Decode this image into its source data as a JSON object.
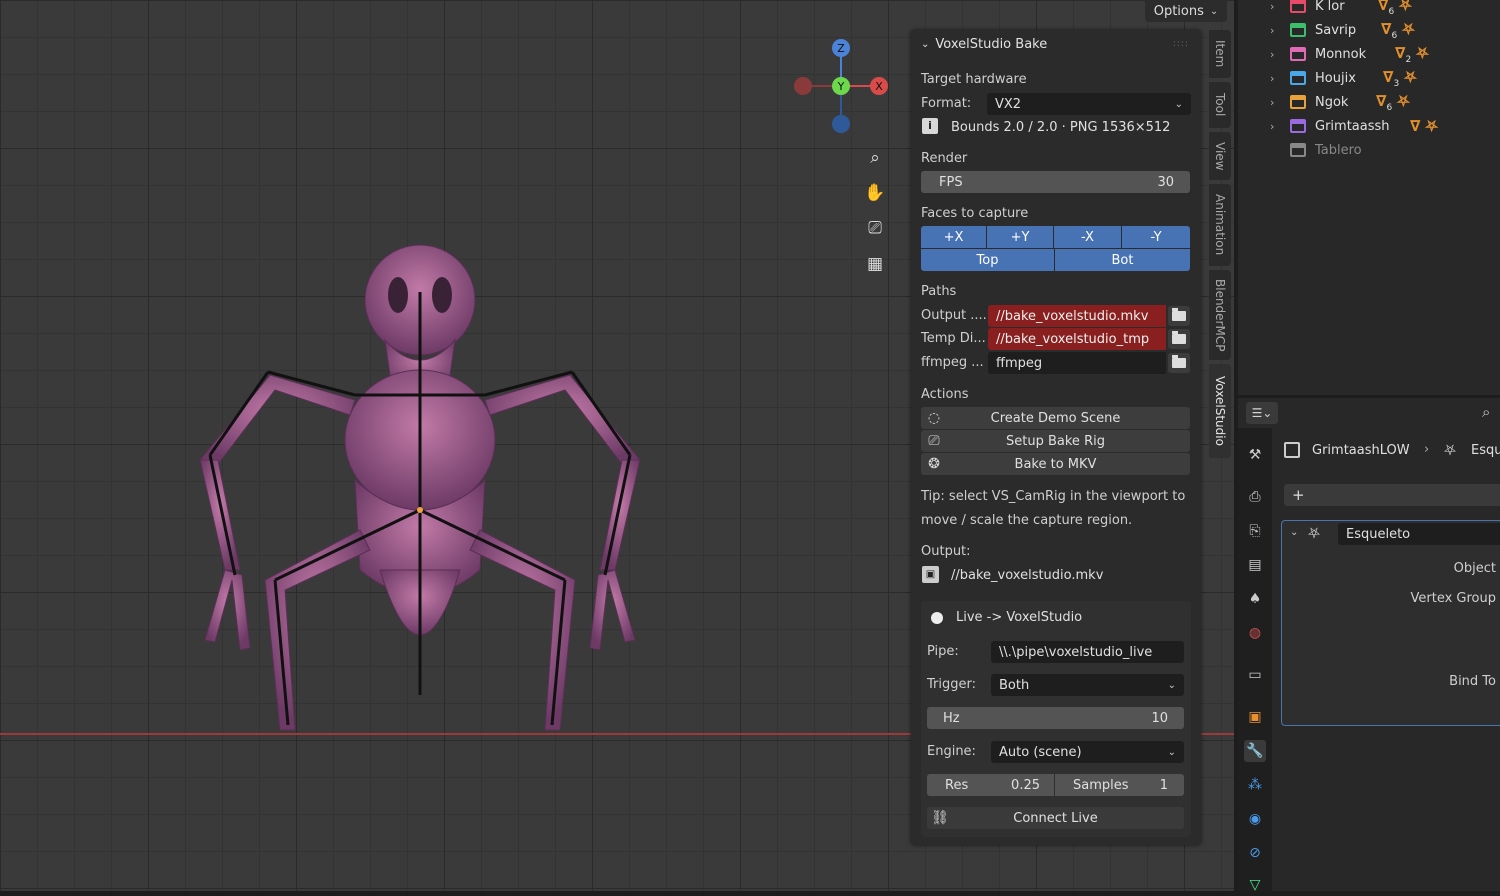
{
  "viewport": {
    "options_label": "Options",
    "gizmo": {
      "z": "Z",
      "y": "Y",
      "x": "X"
    },
    "nav_icons": [
      "zoom-icon",
      "hand-pan-icon",
      "camera-icon",
      "grid-icon"
    ]
  },
  "tabs": [
    "Item",
    "Tool",
    "View",
    "Animation",
    "BlenderMCP",
    "VoxelStudio"
  ],
  "panel": {
    "title": "VoxelStudio Bake",
    "target_hardware": "Target hardware",
    "format_label": "Format:",
    "format_value": "VX2",
    "bounds_info": "Bounds 2.0 / 2.0  ·  PNG 1536×512",
    "render_label": "Render",
    "fps_label": "FPS",
    "fps_value": "30",
    "faces_label": "Faces to capture",
    "faces_row1": [
      "+X",
      "+Y",
      "-X",
      "-Y"
    ],
    "faces_row2": [
      "Top",
      "Bot"
    ],
    "paths_label": "Paths",
    "output_label": "Output ....",
    "output_value": "//bake_voxelstudio.mkv",
    "temp_label": "Temp Di...",
    "temp_value": "//bake_voxelstudio_tmp",
    "ffmpeg_label": "ffmpeg ...",
    "ffmpeg_value": "ffmpeg",
    "actions_label": "Actions",
    "create_demo": "Create Demo Scene",
    "setup_rig": "Setup Bake Rig",
    "bake_mkv": "Bake to MKV",
    "tip_line1": "Tip: select VS_CamRig in the viewport to",
    "tip_line2": "move / scale the capture region.",
    "output_heading": "Output:",
    "output_file": "//bake_voxelstudio.mkv",
    "live": {
      "title": "Live -> VoxelStudio",
      "pipe_label": "Pipe:",
      "pipe_value": "\\\\.\\pipe\\voxelstudio_live",
      "trigger_label": "Trigger:",
      "trigger_value": "Both",
      "hz_label": "Hz",
      "hz_value": "10",
      "engine_label": "Engine:",
      "engine_value": "Auto (scene)",
      "res_label": "Res",
      "res_value": "0.25",
      "samples_label": "Samples",
      "samples_value": "1",
      "connect": "Connect Live"
    }
  },
  "outliner": {
    "items": [
      {
        "name": "K lor",
        "color": "#e84a6a",
        "sub": "6"
      },
      {
        "name": "Savrip",
        "color": "#3bbf6b",
        "sub": "6"
      },
      {
        "name": "Monnok",
        "color": "#e06ab5",
        "sub": "2"
      },
      {
        "name": "Houjix",
        "color": "#4aa8e8",
        "sub": "3"
      },
      {
        "name": "Ngok",
        "color": "#e8a23c",
        "sub": "6"
      },
      {
        "name": "Grimtaassh",
        "color": "#9b6ae0",
        "sub": ""
      },
      {
        "name": "Tablero",
        "color": "#888888",
        "sub": ""
      }
    ]
  },
  "properties": {
    "breadcrumb_object": "GrimtaashLOW",
    "breadcrumb_next": "Esqu",
    "add_label": "+",
    "modifier_name": "Esqueleto",
    "object_label": "Object",
    "vertex_group_label": "Vertex Group",
    "bind_to_label": "Bind To"
  }
}
